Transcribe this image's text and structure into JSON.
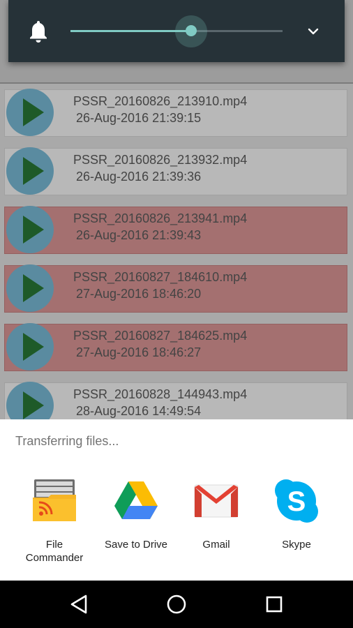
{
  "background_app": {
    "files": [
      {
        "name": "PSSR_20160826_213910.mp4",
        "date": "26-Aug-2016 21:39:15",
        "highlighted": false
      },
      {
        "name": "PSSR_20160826_213932.mp4",
        "date": "26-Aug-2016 21:39:36",
        "highlighted": false
      },
      {
        "name": "PSSR_20160826_213941.mp4",
        "date": "26-Aug-2016 21:39:43",
        "highlighted": true
      },
      {
        "name": "PSSR_20160827_184610.mp4",
        "date": "27-Aug-2016 18:46:20",
        "highlighted": true
      },
      {
        "name": "PSSR_20160827_184625.mp4",
        "date": "27-Aug-2016 18:46:27",
        "highlighted": true
      },
      {
        "name": "PSSR_20160828_144943.mp4",
        "date": "28-Aug-2016 14:49:54",
        "highlighted": false
      }
    ]
  },
  "volume_panel": {
    "icon": "bell-icon",
    "level_fraction": 0.57,
    "expand_icon": "chevron-down-icon"
  },
  "share_sheet": {
    "title": "Transferring files...",
    "targets": [
      {
        "label": "File\nCommander",
        "icon": "file-commander-icon"
      },
      {
        "label": "Save to Drive",
        "icon": "google-drive-icon"
      },
      {
        "label": "Gmail",
        "icon": "gmail-icon"
      },
      {
        "label": "Skype",
        "icon": "skype-icon"
      }
    ]
  },
  "nav_bar": {
    "back": "back-icon",
    "home": "home-icon",
    "recents": "recents-icon"
  },
  "colors": {
    "volume_panel_bg": "#263238",
    "accent": "#80cbc4",
    "highlight_row": "#a47070"
  }
}
